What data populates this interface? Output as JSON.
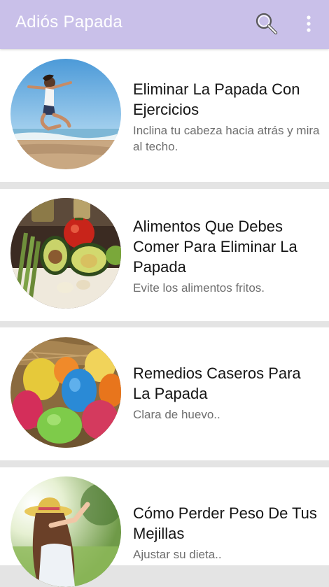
{
  "app_bar": {
    "title": "Adiós Papada",
    "background": "#c9c0e9",
    "search_icon": "search-icon",
    "menu_icon": "more-vert-icon"
  },
  "articles": [
    {
      "title": "Eliminar La Papada Con Ejercicios",
      "subtitle": "Inclina tu cabeza hacia atrás y mira al techo.",
      "image": "woman-jumping-on-beach"
    },
    {
      "title": "Alimentos Que Debes Comer Para Eliminar La Papada",
      "subtitle": "Evite los alimentos fritos.",
      "image": "healthy-food-avocado-asparagus"
    },
    {
      "title": "Remedios Caseros Para La Papada",
      "subtitle": "Clara de huevo..",
      "image": "colored-eggs-in-nest"
    },
    {
      "title": "Cómo Perder Peso De Tus Mejillas",
      "subtitle": "Ajustar su dieta..",
      "image": "woman-with-hat-in-sun"
    }
  ]
}
